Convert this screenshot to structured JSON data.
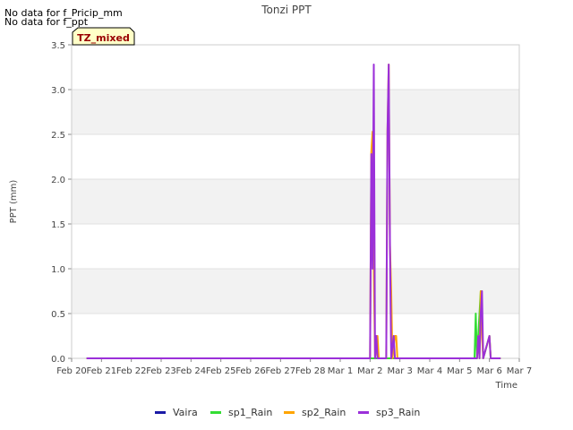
{
  "notes": [
    "No data for f_Pricip_mm",
    "No data for f_ppt"
  ],
  "badge": "TZ_mixed",
  "colors": {
    "Vaira": "#1a1aa6",
    "sp1_Rain": "#33dd33",
    "sp2_Rain": "#ffa500",
    "sp3_Rain": "#9b30d9"
  },
  "chart_data": {
    "type": "line",
    "title": "Tonzi PPT",
    "xlabel": "Time",
    "ylabel": "PPT (mm)",
    "x_ticks": [
      "Feb 20",
      "Feb 21",
      "Feb 22",
      "Feb 23",
      "Feb 24",
      "Feb 25",
      "Feb 26",
      "Feb 27",
      "Feb 28",
      "Mar 1",
      "Mar 2",
      "Mar 3",
      "Mar 4",
      "Mar 5",
      "Mar 6",
      "Mar 7"
    ],
    "y_ticks": [
      "0.0",
      "0.5",
      "1.0",
      "1.5",
      "2.0",
      "2.5",
      "3.0",
      "3.5"
    ],
    "xlim": [
      "Feb 20",
      "Mar 7"
    ],
    "ylim": [
      0,
      3.5
    ],
    "grid": "horizontal bands",
    "legend_position": "bottom",
    "series": [
      {
        "name": "Vaira",
        "points": []
      },
      {
        "name": "sp1_Rain",
        "points": [
          [
            "Feb 20 12:00",
            0
          ],
          [
            "Mar 5 12:00",
            0
          ],
          [
            "Mar 5 13:00",
            0.5
          ],
          [
            "Mar 5 14:00",
            0
          ],
          [
            "Mar 5 17:00",
            0.75
          ],
          [
            "Mar 5 19:00",
            0
          ],
          [
            "Mar 6 00:00",
            0.25
          ],
          [
            "Mar 6 01:00",
            0
          ],
          [
            "Mar 6 09:00",
            0
          ]
        ]
      },
      {
        "name": "sp2_Rain",
        "points": [
          [
            "Feb 20 12:00",
            0
          ],
          [
            "Mar 2 00:00",
            0
          ],
          [
            "Mar 2 01:00",
            2.3
          ],
          [
            "Mar 2 02:00",
            2.53
          ],
          [
            "Mar 2 03:00",
            1.0
          ],
          [
            "Mar 2 04:00",
            0
          ],
          [
            "Mar 2 06:00",
            0.25
          ],
          [
            "Mar 2 07:00",
            0
          ],
          [
            "Mar 2 13:00",
            0
          ],
          [
            "Mar 2 14:00",
            2.53
          ],
          [
            "Mar 2 15:00",
            3.28
          ],
          [
            "Mar 2 16:00",
            1.26
          ],
          [
            "Mar 2 17:00",
            0.76
          ],
          [
            "Mar 2 18:00",
            0
          ],
          [
            "Mar 2 20:00",
            0.25
          ],
          [
            "Mar 2 21:00",
            0.25
          ],
          [
            "Mar 2 22:00",
            0
          ],
          [
            "Mar 5 14:00",
            0
          ],
          [
            "Mar 5 15:00",
            0.25
          ],
          [
            "Mar 5 16:00",
            0
          ],
          [
            "Mar 5 17:00",
            0.75
          ],
          [
            "Mar 5 18:00",
            0.25
          ],
          [
            "Mar 5 19:00",
            0
          ],
          [
            "Mar 6 00:00",
            0.25
          ],
          [
            "Mar 6 01:00",
            0
          ],
          [
            "Mar 6 09:00",
            0
          ]
        ]
      },
      {
        "name": "sp3_Rain",
        "points": [
          [
            "Feb 20 12:00",
            0
          ],
          [
            "Mar 2 00:00",
            0
          ],
          [
            "Mar 2 01:00",
            2.28
          ],
          [
            "Mar 2 02:00",
            1.0
          ],
          [
            "Mar 2 03:00",
            3.28
          ],
          [
            "Mar 2 04:00",
            0
          ],
          [
            "Mar 2 05:00",
            0.25
          ],
          [
            "Mar 2 06:00",
            0
          ],
          [
            "Mar 2 13:00",
            0
          ],
          [
            "Mar 2 14:00",
            2.53
          ],
          [
            "Mar 2 15:00",
            3.28
          ],
          [
            "Mar 2 16:00",
            1.26
          ],
          [
            "Mar 2 17:00",
            0
          ],
          [
            "Mar 2 19:00",
            0.25
          ],
          [
            "Mar 2 20:00",
            0
          ],
          [
            "Mar 5 14:00",
            0
          ],
          [
            "Mar 5 15:00",
            0.25
          ],
          [
            "Mar 5 16:00",
            0
          ],
          [
            "Mar 5 17:00",
            0.5
          ],
          [
            "Mar 5 18:00",
            0.75
          ],
          [
            "Mar 5 19:00",
            0
          ],
          [
            "Mar 6 00:00",
            0.25
          ],
          [
            "Mar 6 01:00",
            0
          ],
          [
            "Mar 6 09:00",
            0
          ]
        ]
      }
    ]
  }
}
